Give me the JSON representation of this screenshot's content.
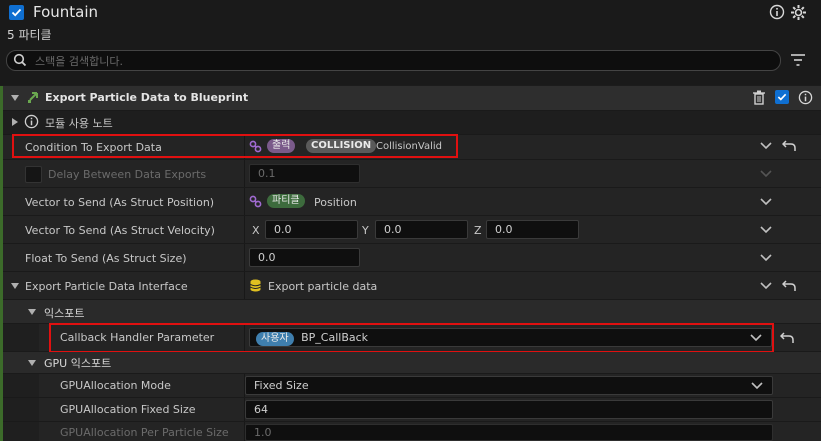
{
  "header": {
    "title": "Fountain",
    "subtitle": "5 파티클",
    "search_placeholder": "스택을 검색합니다."
  },
  "module": {
    "title": "Export Particle Data to Blueprint",
    "notes_label": "모듈 사용 노트"
  },
  "properties": {
    "condition_label": "Condition To Export Data",
    "condition_pill_output": "출력",
    "condition_pill_collision": "COLLISION",
    "condition_value": "CollisionValid",
    "delay_label": "Delay Between Data Exports",
    "delay_value": "0.1",
    "vector_pos_label": "Vector to Send (As Struct Position)",
    "vector_pos_pill": "파티클",
    "vector_pos_value": "Position",
    "vector_vel_label": "Vector To Send (As Struct Velocity)",
    "x_label": "X",
    "y_label": "Y",
    "z_label": "Z",
    "x_value": "0.0",
    "y_value": "0.0",
    "z_value": "0.0",
    "float_label": "Float To Send (As Struct Size)",
    "float_value": "0.0",
    "interface_label": "Export Particle Data Interface",
    "interface_value": "Export particle data",
    "export_section": "익스포트",
    "callback_label": "Callback Handler Parameter",
    "callback_pill": "사용자",
    "callback_value": "BP_CallBack",
    "gpu_section": "GPU 익스포트",
    "gpu_mode_label": "GPUAllocation Mode",
    "gpu_mode_value": "Fixed Size",
    "gpu_fixed_label": "GPUAllocation Fixed Size",
    "gpu_fixed_value": "64",
    "gpu_per_label": "GPUAllocation Per Particle Size",
    "gpu_per_value": "1.0"
  },
  "colors": {
    "highlight": "#e01010",
    "accent_blue": "#0f6fd1",
    "pill_output": "#7a5a8a",
    "pill_collision": "#5a5a5a",
    "pill_particle": "#3d6b3d",
    "pill_user": "#3f7fae"
  }
}
